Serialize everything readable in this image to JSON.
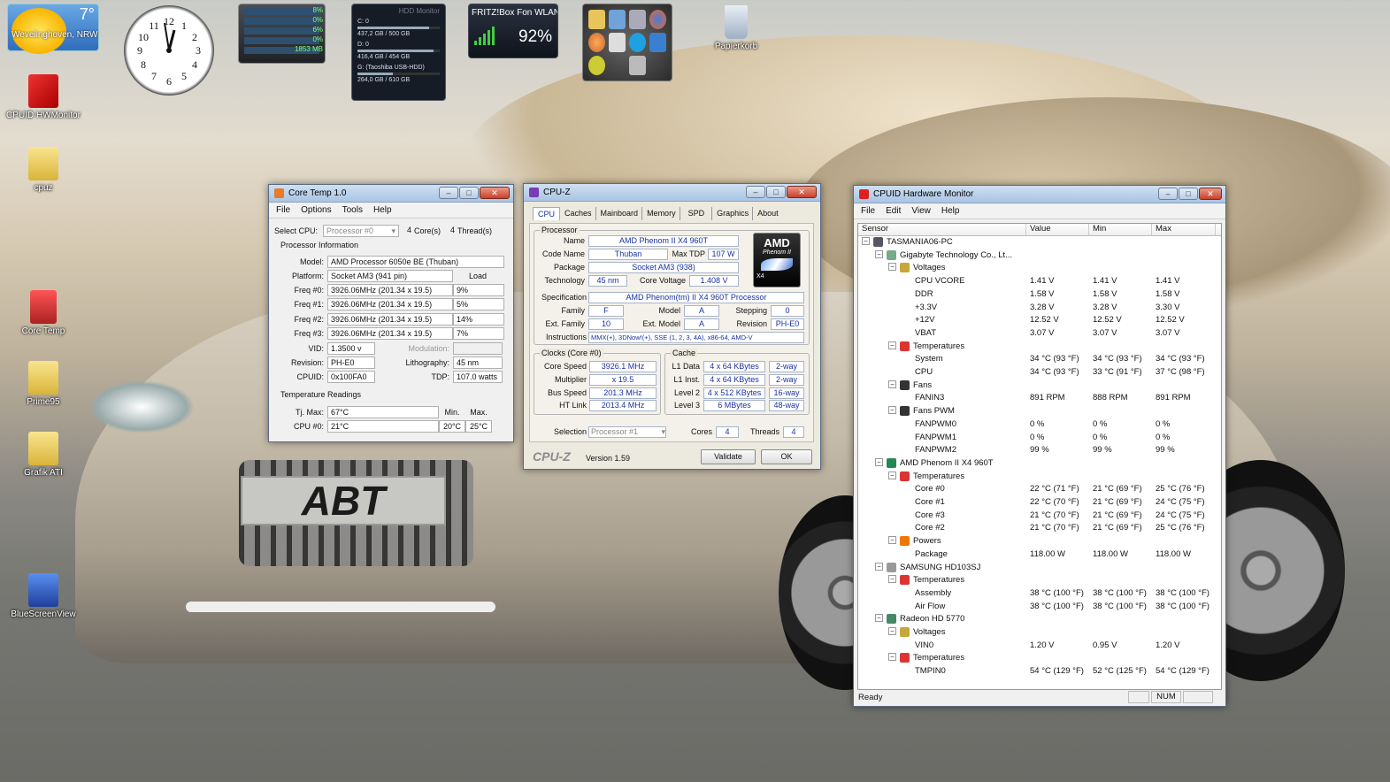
{
  "desktop": {
    "icons": [
      {
        "label": "CPUID HWMonitor"
      },
      {
        "label": "cpuz"
      },
      {
        "label": "Core Temp"
      },
      {
        "label": "Prime95"
      },
      {
        "label": "Grafik ATI"
      },
      {
        "label": "BlueScreenView"
      },
      {
        "label": "Papierkorb"
      }
    ],
    "wallpaper_brand": "ABT"
  },
  "weather": {
    "temp": "7°",
    "city": "Wevelinghoven, NRW"
  },
  "meter": {
    "values": [
      "8%",
      "0%",
      "6%",
      "0%",
      "1853 MB"
    ]
  },
  "hdd": {
    "title": "HDD Monitor",
    "drives": [
      {
        "name": "C: 0",
        "size": "437,2 GB / 500 GB",
        "fill": 0.87
      },
      {
        "name": "D: 0",
        "size": "416,4 GB / 454 GB",
        "fill": 0.92
      },
      {
        "name": "G: (Taoshiba USB-HDD)",
        "size": "264,0 GB / 610 GB",
        "fill": 0.43
      }
    ]
  },
  "fritz": {
    "title": "FRITZ!Box Fon WLAN",
    "signal": "92%"
  },
  "coretemp": {
    "title": "Core Temp 1.0",
    "menu": [
      "File",
      "Options",
      "Tools",
      "Help"
    ],
    "select_cpu_label": "Select CPU:",
    "select_cpu_value": "Processor #0",
    "cores": "4",
    "cores_label": "Core(s)",
    "threads": "4",
    "threads_label": "Thread(s)",
    "proc_info_label": "Processor Information",
    "model_label": "Model:",
    "model": "AMD Processor 6050e BE (Thuban)",
    "platform_label": "Platform:",
    "platform": "Socket AM3 (941 pin)",
    "load_label": "Load",
    "freqs": [
      {
        "label": "Freq #0:",
        "value": "3926.06MHz (201.34 x 19.5)",
        "load": "9%"
      },
      {
        "label": "Freq #1:",
        "value": "3926.06MHz (201.34 x 19.5)",
        "load": "5%"
      },
      {
        "label": "Freq #2:",
        "value": "3926.06MHz (201.34 x 19.5)",
        "load": "14%"
      },
      {
        "label": "Freq #3:",
        "value": "3926.06MHz (201.34 x 19.5)",
        "load": "7%"
      }
    ],
    "vid_label": "VID:",
    "vid": "1.3500 v",
    "modulation_label": "Modulation:",
    "revision_label": "Revision:",
    "revision": "PH-E0",
    "litho_label": "Lithography:",
    "litho": "45 nm",
    "cpuid_label": "CPUID:",
    "cpuid": "0x100FA0",
    "tdp_label": "TDP:",
    "tdp": "107.0 watts",
    "temp_readings_label": "Temperature Readings",
    "tjmax_label": "Tj. Max:",
    "tjmax": "67°C",
    "min_label": "Min.",
    "max_label": "Max.",
    "cpu0_label": "CPU #0:",
    "cpu0": "21°C",
    "cpu0_min": "20°C",
    "cpu0_max": "25°C"
  },
  "cpuz": {
    "title": "CPU-Z",
    "tabs": [
      "CPU",
      "Caches",
      "Mainboard",
      "Memory",
      "SPD",
      "Graphics",
      "About"
    ],
    "processor_label": "Processor",
    "name_label": "Name",
    "name": "AMD Phenom II X4 960T",
    "codename_label": "Code Name",
    "codename": "Thuban",
    "maxtdp_label": "Max TDP",
    "maxtdp": "107 W",
    "package_label": "Package",
    "package": "Socket AM3 (938)",
    "technology_label": "Technology",
    "technology": "45 nm",
    "corevoltage_label": "Core Voltage",
    "corevoltage": "1.408 V",
    "spec_label": "Specification",
    "spec": "AMD Phenom(tm) II X4 960T Processor",
    "family_label": "Family",
    "family": "F",
    "model_label": "Model",
    "model": "A",
    "stepping_label": "Stepping",
    "stepping": "0",
    "extfamily_label": "Ext. Family",
    "extfamily": "10",
    "extmodel_label": "Ext. Model",
    "extmodel": "A",
    "revision_label": "Revision",
    "revision": "PH-E0",
    "instructions_label": "Instructions",
    "instructions": "MMX(+), 3DNow!(+), SSE (1, 2, 3, 4A), x86-64, AMD-V",
    "clocks_label": "Clocks (Core #0)",
    "corespeed_label": "Core Speed",
    "corespeed": "3926.1 MHz",
    "multiplier_label": "Multiplier",
    "multiplier": "x 19.5",
    "busspeed_label": "Bus Speed",
    "busspeed": "201.3 MHz",
    "htlink_label": "HT Link",
    "htlink": "2013.4 MHz",
    "cache_label": "Cache",
    "l1data_label": "L1 Data",
    "l1data": "4 x 64 KBytes",
    "l1data_way": "2-way",
    "l1inst_label": "L1 Inst.",
    "l1inst": "4 x 64 KBytes",
    "l1inst_way": "2-way",
    "level2_label": "Level 2",
    "level2": "4 x 512 KBytes",
    "level2_way": "16-way",
    "level3_label": "Level 3",
    "level3": "6 MBytes",
    "level3_way": "48-way",
    "selection_label": "Selection",
    "selection": "Processor #1",
    "cores_label": "Cores",
    "cores": "4",
    "threads_label": "Threads",
    "threads": "4",
    "logo_text": "CPU-Z",
    "version": "Version 1.59",
    "validate": "Validate",
    "ok": "OK",
    "amd_logo": "AMD",
    "phenom_logo": "Phenom II",
    "x4_logo": "X4"
  },
  "hwmon": {
    "title": "CPUID Hardware Monitor",
    "menu": [
      "File",
      "Edit",
      "View",
      "Help"
    ],
    "columns": [
      "Sensor",
      "Value",
      "Min",
      "Max"
    ],
    "rows": [
      {
        "level": 0,
        "icon": "computer-icon",
        "name": "TASMANIA06-PC",
        "value": "",
        "min": "",
        "max": ""
      },
      {
        "level": 1,
        "icon": "motherboard-icon",
        "name": "Gigabyte Technology Co., Lt...",
        "value": "",
        "min": "",
        "max": ""
      },
      {
        "level": 2,
        "icon": "voltage-icon",
        "name": "Voltages",
        "value": "",
        "min": "",
        "max": ""
      },
      {
        "level": 3,
        "icon": "",
        "name": "CPU VCORE",
        "value": "1.41 V",
        "min": "1.41 V",
        "max": "1.41 V"
      },
      {
        "level": 3,
        "icon": "",
        "name": "DDR",
        "value": "1.58 V",
        "min": "1.58 V",
        "max": "1.58 V"
      },
      {
        "level": 3,
        "icon": "",
        "name": "+3.3V",
        "value": "3.28 V",
        "min": "3.28 V",
        "max": "3.30 V"
      },
      {
        "level": 3,
        "icon": "",
        "name": "+12V",
        "value": "12.52 V",
        "min": "12.52 V",
        "max": "12.52 V"
      },
      {
        "level": 3,
        "icon": "",
        "name": "VBAT",
        "value": "3.07 V",
        "min": "3.07 V",
        "max": "3.07 V"
      },
      {
        "level": 2,
        "icon": "thermometer-icon",
        "name": "Temperatures",
        "value": "",
        "min": "",
        "max": ""
      },
      {
        "level": 3,
        "icon": "",
        "name": "System",
        "value": "34 °C (93 °F)",
        "min": "34 °C (93 °F)",
        "max": "34 °C (93 °F)"
      },
      {
        "level": 3,
        "icon": "",
        "name": "CPU",
        "value": "34 °C (93 °F)",
        "min": "33 °C (91 °F)",
        "max": "37 °C (98 °F)"
      },
      {
        "level": 2,
        "icon": "fan-icon",
        "name": "Fans",
        "value": "",
        "min": "",
        "max": ""
      },
      {
        "level": 3,
        "icon": "",
        "name": "FANIN3",
        "value": "891 RPM",
        "min": "888 RPM",
        "max": "891 RPM"
      },
      {
        "level": 2,
        "icon": "fan-icon",
        "name": "Fans PWM",
        "value": "",
        "min": "",
        "max": ""
      },
      {
        "level": 3,
        "icon": "",
        "name": "FANPWM0",
        "value": "0 %",
        "min": "0 %",
        "max": "0 %"
      },
      {
        "level": 3,
        "icon": "",
        "name": "FANPWM1",
        "value": "0 %",
        "min": "0 %",
        "max": "0 %"
      },
      {
        "level": 3,
        "icon": "",
        "name": "FANPWM2",
        "value": "99 %",
        "min": "99 %",
        "max": "99 %"
      },
      {
        "level": 1,
        "icon": "chip-icon",
        "name": "AMD Phenom II X4 960T",
        "value": "",
        "min": "",
        "max": ""
      },
      {
        "level": 2,
        "icon": "thermometer-icon",
        "name": "Temperatures",
        "value": "",
        "min": "",
        "max": ""
      },
      {
        "level": 3,
        "icon": "",
        "name": "Core #0",
        "value": "22 °C (71 °F)",
        "min": "21 °C (69 °F)",
        "max": "25 °C (76 °F)"
      },
      {
        "level": 3,
        "icon": "",
        "name": "Core #1",
        "value": "22 °C (70 °F)",
        "min": "21 °C (69 °F)",
        "max": "24 °C (75 °F)"
      },
      {
        "level": 3,
        "icon": "",
        "name": "Core #3",
        "value": "21 °C (70 °F)",
        "min": "21 °C (69 °F)",
        "max": "24 °C (75 °F)"
      },
      {
        "level": 3,
        "icon": "",
        "name": "Core #2",
        "value": "21 °C (70 °F)",
        "min": "21 °C (69 °F)",
        "max": "25 °C (76 °F)"
      },
      {
        "level": 2,
        "icon": "power-icon",
        "name": "Powers",
        "value": "",
        "min": "",
        "max": ""
      },
      {
        "level": 3,
        "icon": "",
        "name": "Package",
        "value": "118.00 W",
        "min": "118.00 W",
        "max": "118.00 W"
      },
      {
        "level": 1,
        "icon": "disk-icon",
        "name": "SAMSUNG HD103SJ",
        "value": "",
        "min": "",
        "max": ""
      },
      {
        "level": 2,
        "icon": "thermometer-icon",
        "name": "Temperatures",
        "value": "",
        "min": "",
        "max": ""
      },
      {
        "level": 3,
        "icon": "",
        "name": "Assembly",
        "value": "38 °C (100 °F)",
        "min": "38 °C (100 °F)",
        "max": "38 °C (100 °F)"
      },
      {
        "level": 3,
        "icon": "",
        "name": "Air Flow",
        "value": "38 °C (100 °F)",
        "min": "38 °C (100 °F)",
        "max": "38 °C (100 °F)"
      },
      {
        "level": 1,
        "icon": "gpu-icon",
        "name": "Radeon HD 5770",
        "value": "",
        "min": "",
        "max": ""
      },
      {
        "level": 2,
        "icon": "voltage-icon",
        "name": "Voltages",
        "value": "",
        "min": "",
        "max": ""
      },
      {
        "level": 3,
        "icon": "",
        "name": "VIN0",
        "value": "1.20 V",
        "min": "0.95 V",
        "max": "1.20 V"
      },
      {
        "level": 2,
        "icon": "thermometer-icon",
        "name": "Temperatures",
        "value": "",
        "min": "",
        "max": ""
      },
      {
        "level": 3,
        "icon": "",
        "name": "TMPIN0",
        "value": "54 °C (129 °F)",
        "min": "52 °C (125 °F)",
        "max": "54 °C (129 °F)"
      }
    ],
    "status": "Ready",
    "num": "NUM"
  }
}
